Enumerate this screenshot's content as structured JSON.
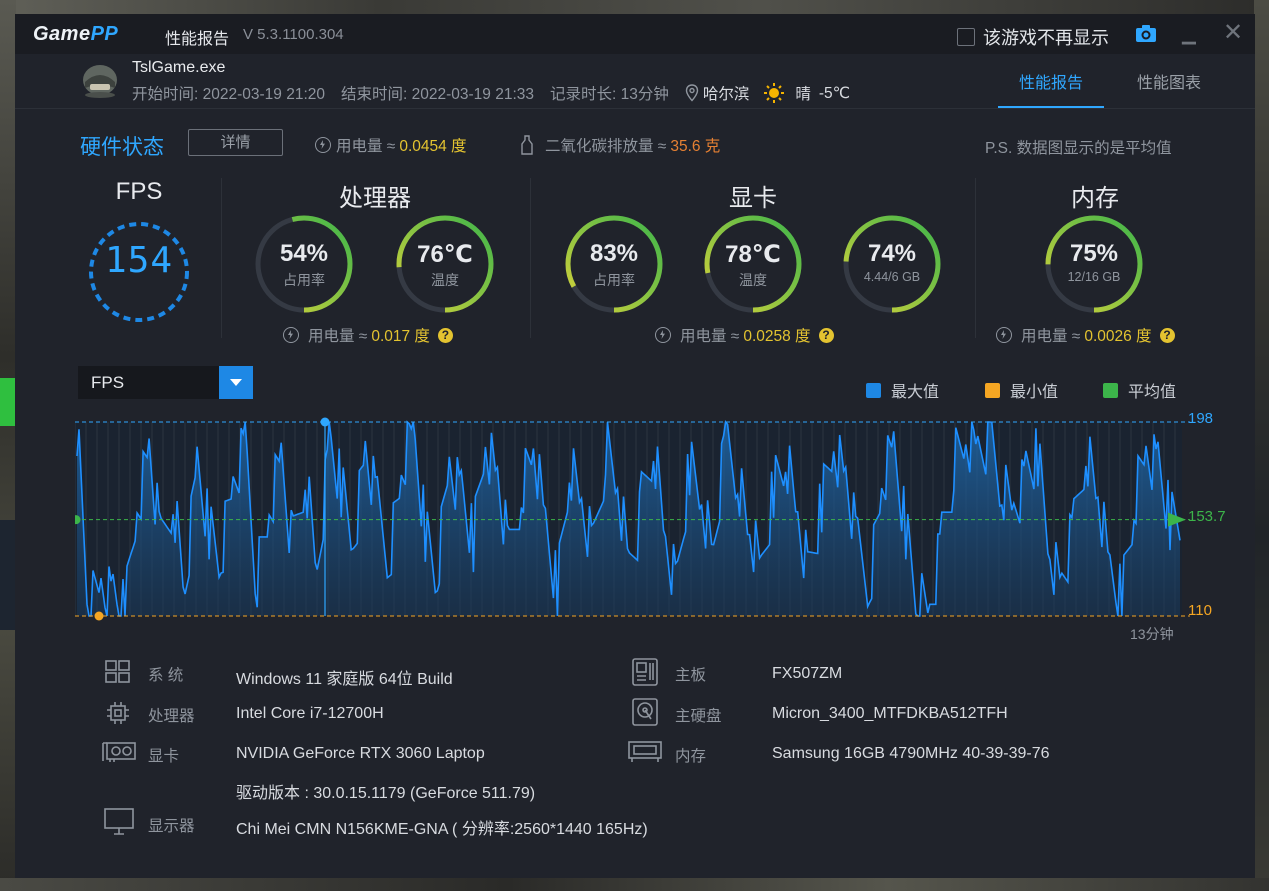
{
  "app": {
    "logo_main": "Game",
    "logo_accent": "PP",
    "window_title": "性能报告",
    "version": "V 5.3.1100.304",
    "no_show_label": "该游戏不再显示"
  },
  "session": {
    "exe": "TslGame.exe",
    "start": "开始时间: 2022-03-19 21:20",
    "end": "结束时间: 2022-03-19 21:33",
    "duration": "记录时长: 13分钟",
    "city": "哈尔滨",
    "weather": "晴",
    "temperature": "-5℃"
  },
  "tabs": [
    "性能报告",
    "性能图表"
  ],
  "hardware": {
    "title": "硬件状态",
    "detail_button": "详情",
    "power_label": "用电量 ≈",
    "power_value": "0.0454 度",
    "co2_label": "二氧化碳排放量 ≈",
    "co2_value": "35.6 克",
    "note": "P.S. 数据图显示的是平均值"
  },
  "fps": {
    "title": "FPS",
    "value": "154"
  },
  "cpu": {
    "title": "处理器",
    "usage": {
      "value": "54%",
      "label": "占用率",
      "fraction": 0.54
    },
    "temp": {
      "value": "76℃",
      "label": "温度",
      "fraction": 0.76
    },
    "power_label": "用电量 ≈",
    "power_value": "0.017 度"
  },
  "gpu": {
    "title": "显卡",
    "usage": {
      "value": "83%",
      "label": "占用率",
      "fraction": 0.83
    },
    "temp": {
      "value": "78℃",
      "label": "温度",
      "fraction": 0.78
    },
    "vram": {
      "value": "74%",
      "label": "4.44/6 GB",
      "fraction": 0.74
    },
    "power_label": "用电量 ≈",
    "power_value": "0.0258 度"
  },
  "memory": {
    "title": "内存",
    "usage": {
      "value": "75%",
      "label": "12/16 GB",
      "fraction": 0.75
    },
    "power_label": "用电量 ≈",
    "power_value": "0.0026 度"
  },
  "chart_controls": {
    "metric_select": "FPS",
    "legend": [
      {
        "label": "最大值",
        "color": "#1e88e5"
      },
      {
        "label": "最小值",
        "color": "#f5a623"
      },
      {
        "label": "平均值",
        "color": "#3cb54a"
      }
    ]
  },
  "chart_data": {
    "type": "area",
    "series": [
      {
        "values": [
          198,
          112,
          125,
          118,
          110,
          160,
          185,
          140,
          165,
          120,
          178,
          150,
          135,
          170,
          188,
          125,
          158,
          182,
          140,
          175,
          130,
          190,
          168,
          145,
          185,
          160,
          138,
          175,
          195,
          150,
          128,
          180,
          165,
          142,
          190,
          172,
          135,
          168,
          186,
          150,
          122,
          176,
          160,
          140,
          185,
          170,
          132,
          160,
          188,
          145,
          125,
          178,
          165,
          138,
          192,
          175,
          148,
          130,
          170,
          182,
          155,
          128,
          160,
          188,
          172,
          140,
          125,
          168,
          185,
          150,
          115,
          112,
          145,
          178,
          190,
          185,
          192,
          168,
          160,
          175,
          182,
          140,
          125,
          150,
          188,
          165,
          130,
          120,
          160,
          185,
          178,
          152
        ]
      }
    ],
    "y_max": 198,
    "y_min": 110,
    "y_avg": 153.7,
    "y_max_label": "198",
    "y_min_label": "110",
    "y_avg_label": "153.7",
    "x_end_label": "13分钟"
  },
  "system_info": {
    "os_label": "系  统",
    "os_value": "Windows 11 家庭版 64位   Build",
    "cpu_label": "处理器",
    "cpu_value": "Intel Core i7-12700H",
    "gpu_label": "显卡",
    "gpu_value": "NVIDIA GeForce RTX 3060 Laptop",
    "driver_value": "驱动版本 : 30.0.15.1179 (GeForce 511.79)",
    "monitor_label": "显示器",
    "monitor_value": "Chi Mei CMN N156KME-GNA ( 分辨率:2560*1440 165Hz)",
    "board_label": "主板",
    "board_value": "FX507ZM",
    "disk_label": "主硬盘",
    "disk_value": "Micron_3400_MTFDKBA512TFH",
    "ram_label": "内存",
    "ram_value": "Samsung 16GB 4790MHz 40-39-39-76"
  }
}
